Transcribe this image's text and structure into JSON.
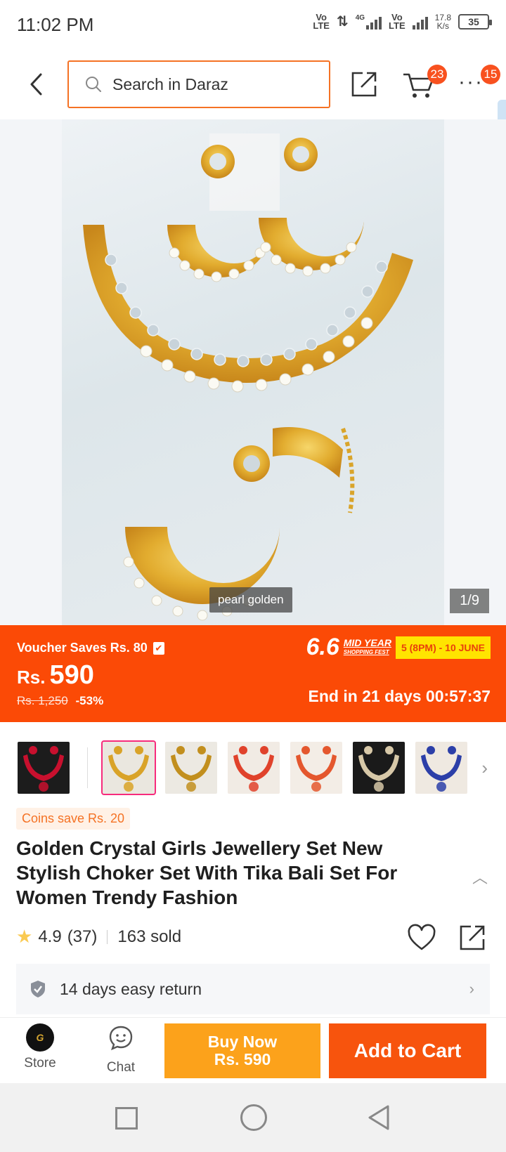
{
  "status_bar": {
    "time": "11:02 PM",
    "net1": "Vo\nLTE",
    "net_4g": "4G",
    "net2": "Vo\nLTE",
    "speed": "17.8\nK/s",
    "battery": "35"
  },
  "header": {
    "search_placeholder": "Search in Daraz",
    "cart_badge": "23",
    "more_badge": "15"
  },
  "gallery": {
    "image_label": "pearl golden",
    "counter": "1/9"
  },
  "price": {
    "voucher": "Voucher Saves Rs. 80",
    "currency": "Rs.",
    "amount": "590",
    "original": "Rs. 1,250",
    "discount": "-53%",
    "campaign_number": "6.6",
    "campaign_title": "MID YEAR",
    "campaign_sub": "SHOPPING FEST",
    "campaign_dates": "5 (8PM) - 10 JUNE",
    "countdown": "End in 21 days 00:57:37"
  },
  "thumbnails": [
    {
      "bg": "#1c1c1c",
      "accent": "#c8102e"
    },
    {
      "bg": "#eae7df",
      "accent": "#d9a328",
      "selected": true
    },
    {
      "bg": "#ece9e2",
      "accent": "#c28f1e"
    },
    {
      "bg": "#f1ebe4",
      "accent": "#e0422b"
    },
    {
      "bg": "#f3ede6",
      "accent": "#e4572e"
    },
    {
      "bg": "#1a1a1a",
      "accent": "#d7c8a8"
    },
    {
      "bg": "#efe9e1",
      "accent": "#2c3fa8"
    }
  ],
  "product": {
    "coins": "Coins save Rs. 20",
    "title": "Golden Crystal Girls Jewellery Set New Stylish Choker Set With Tika Bali Set For Women Trendy Fashion",
    "rating": "4.9",
    "reviews": "(37)",
    "sold": "163 sold",
    "return_policy": "14 days easy return"
  },
  "bottom_bar": {
    "store_label": "Store",
    "chat_label": "Chat",
    "buy_now_label": "Buy Now",
    "buy_now_price": "Rs. 590",
    "add_to_cart_label": "Add to Cart"
  },
  "colors": {
    "brand_orange": "#f57224",
    "banner_orange": "#fb4a06",
    "buy_now": "#fca21b",
    "add_to_cart": "#f7540d"
  }
}
